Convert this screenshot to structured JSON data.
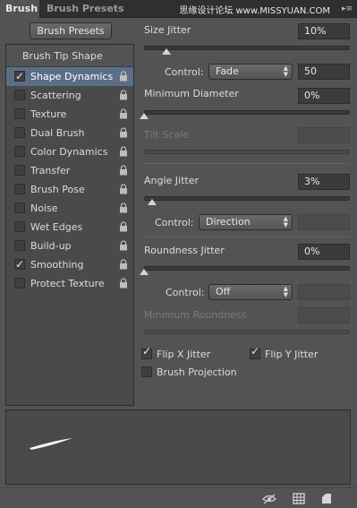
{
  "tabs": [
    {
      "label": "Brush",
      "active": true
    },
    {
      "label": "Brush Presets",
      "active": false
    }
  ],
  "watermark": "思缘设计论坛 www.MISSYUAN.COM",
  "brush_presets_button": "Brush Presets",
  "brush_tip_shape": "Brush Tip Shape",
  "options": [
    {
      "label": "Shape Dynamics",
      "checked": true,
      "selected": true
    },
    {
      "label": "Scattering",
      "checked": false
    },
    {
      "label": "Texture",
      "checked": false
    },
    {
      "label": "Dual Brush",
      "checked": false
    },
    {
      "label": "Color Dynamics",
      "checked": false
    },
    {
      "label": "Transfer",
      "checked": false
    },
    {
      "label": "Brush Pose",
      "checked": false
    },
    {
      "label": "Noise",
      "checked": false
    },
    {
      "label": "Wet Edges",
      "checked": false
    },
    {
      "label": "Build-up",
      "checked": false
    },
    {
      "label": "Smoothing",
      "checked": true
    },
    {
      "label": "Protect Texture",
      "checked": false
    }
  ],
  "size_jitter": {
    "label": "Size Jitter",
    "value": "10%",
    "level": 0.1
  },
  "size_control": {
    "label": "Control:",
    "selected": "Fade",
    "value": "50"
  },
  "minimum_diameter": {
    "label": "Minimum Diameter",
    "value": "0%",
    "level": 0.0
  },
  "tilt_scale": {
    "label": "Tilt Scale",
    "value": ""
  },
  "angle_jitter": {
    "label": "Angle Jitter",
    "value": "3%",
    "level": 0.03
  },
  "angle_control": {
    "label": "Control:",
    "selected": "Direction",
    "value": ""
  },
  "roundness_jitter": {
    "label": "Roundness Jitter",
    "value": "0%",
    "level": 0.0
  },
  "roundness_control": {
    "label": "Control:",
    "selected": "Off",
    "value": ""
  },
  "minimum_roundness": {
    "label": "Minimum Roundness",
    "value": ""
  },
  "flip_x": {
    "label": "Flip X Jitter",
    "checked": true
  },
  "flip_y": {
    "label": "Flip Y Jitter",
    "checked": true
  },
  "brush_projection": {
    "label": "Brush Projection",
    "checked": false
  },
  "icons": {
    "lock": "lock-icon",
    "visibility_toggle": "eye-icon",
    "grid": "grid-icon",
    "new_preset": "new-preset-icon",
    "panel_menu": "panel-menu-icon"
  }
}
